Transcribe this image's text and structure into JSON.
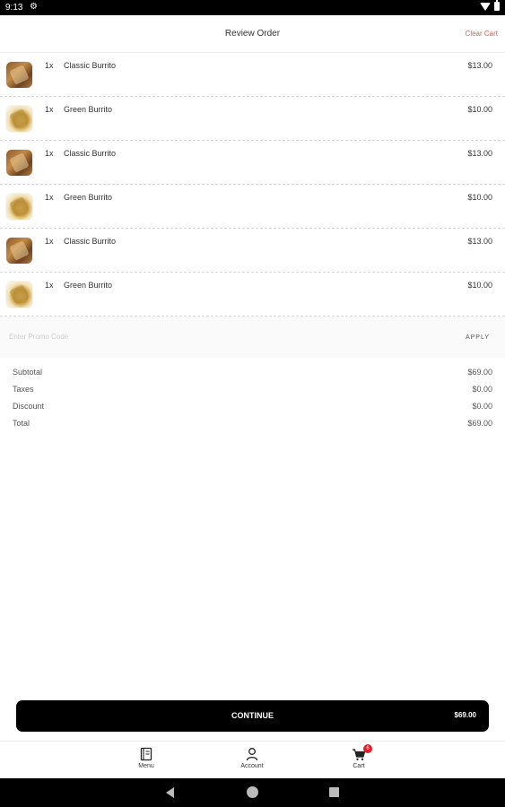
{
  "status_bar": {
    "time": "9:13"
  },
  "header": {
    "title": "Review Order",
    "clear_cart": "Clear Cart"
  },
  "items": [
    {
      "qty": "1x",
      "name": "Classic Burrito",
      "price": "$13.00",
      "image": "classic"
    },
    {
      "qty": "1x",
      "name": "Green Burrito",
      "price": "$10.00",
      "image": "green"
    },
    {
      "qty": "1x",
      "name": "Classic Burrito",
      "price": "$13.00",
      "image": "classic"
    },
    {
      "qty": "1x",
      "name": "Green Burrito",
      "price": "$10.00",
      "image": "green"
    },
    {
      "qty": "1x",
      "name": "Classic Burrito",
      "price": "$13.00",
      "image": "classic"
    },
    {
      "qty": "1x",
      "name": "Green Burrito",
      "price": "$10.00",
      "image": "green"
    }
  ],
  "promo": {
    "placeholder": "Enter Promo Code",
    "value": "",
    "apply_label": "APPLY"
  },
  "totals": [
    {
      "label": "Subtotal",
      "value": "$69.00"
    },
    {
      "label": "Taxes",
      "value": "$0.00"
    },
    {
      "label": "Discount",
      "value": "$0.00"
    },
    {
      "label": "Total",
      "value": "$69.00"
    }
  ],
  "continue": {
    "label": "CONTINUE",
    "price": "$69.00"
  },
  "bottom_nav": {
    "menu": {
      "label": "Menu",
      "icon": "menu-book-icon"
    },
    "account": {
      "label": "Account",
      "icon": "person-icon"
    },
    "cart": {
      "label": "Cart",
      "icon": "cart-icon",
      "badge": "6"
    }
  },
  "colors": {
    "accent": "#e05a5a",
    "badge": "#e0202a",
    "button": "#000000"
  }
}
